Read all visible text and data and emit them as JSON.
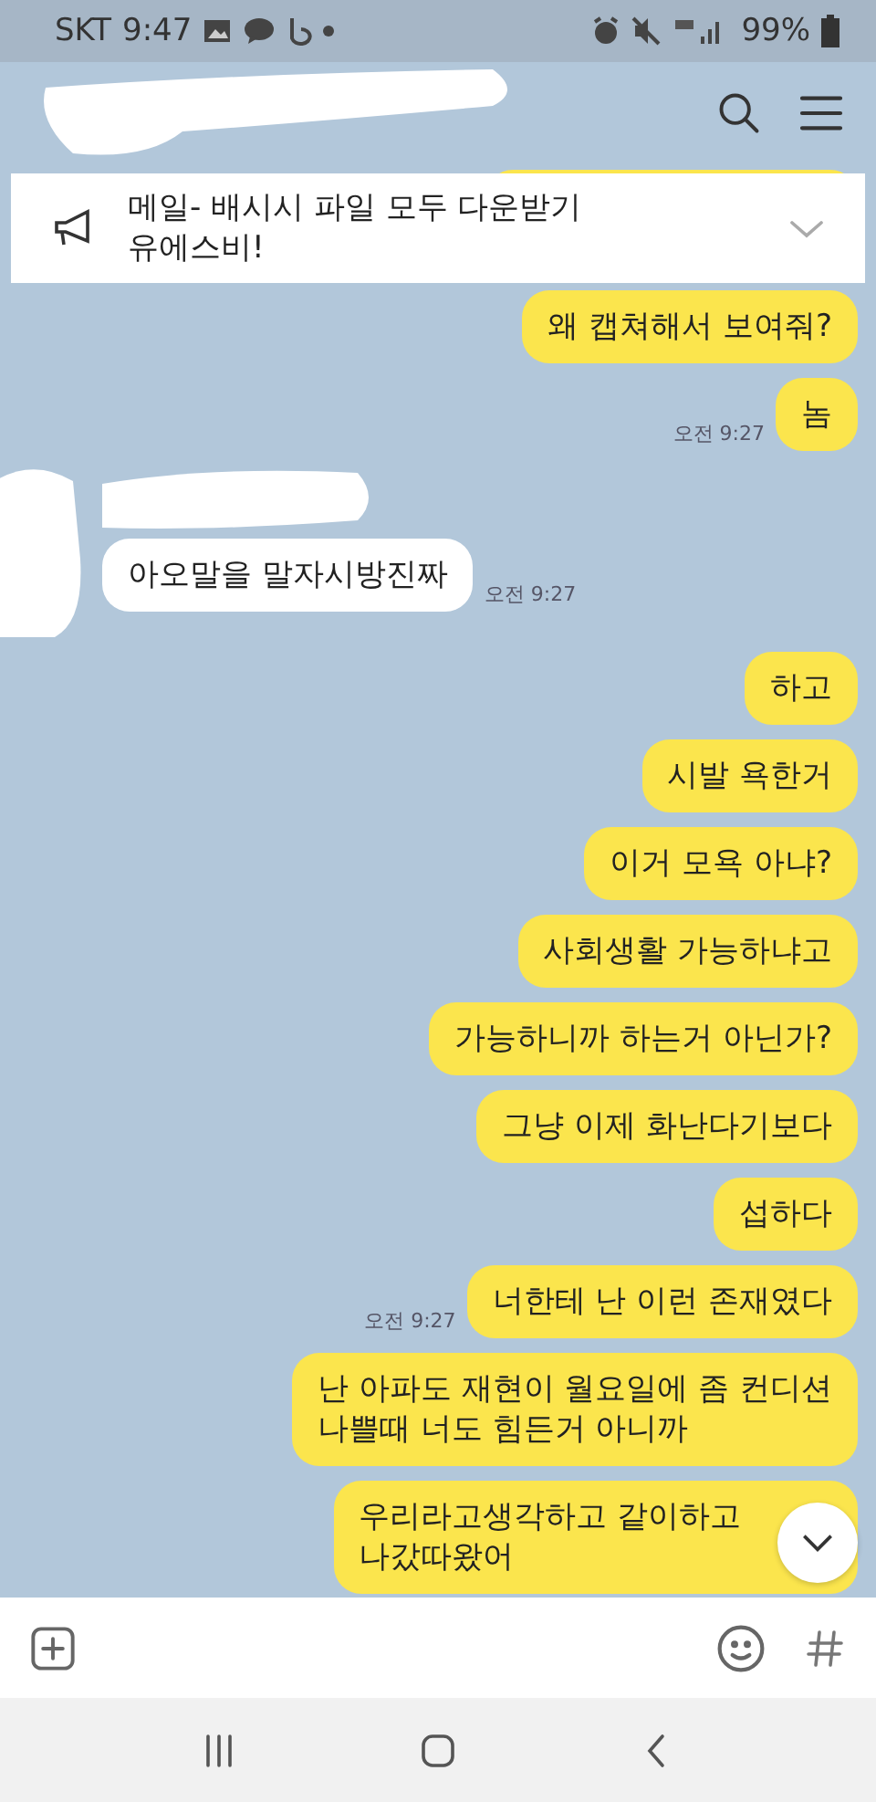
{
  "status_bar": {
    "carrier": "SKT",
    "time": "9:47",
    "battery": "99%"
  },
  "notice": {
    "text": "메일- 배시시 파일 모두 다운받기\n유에스비!"
  },
  "messages": [
    {
      "kind": "partial"
    },
    {
      "kind": "sent",
      "text": "왜 캡쳐해서 보여줘?"
    },
    {
      "kind": "sent",
      "text": "놈",
      "time": "오전 9:27"
    },
    {
      "kind": "received",
      "text": "아오말을 말자시방진짜",
      "time": "오전 9:27"
    },
    {
      "kind": "sent",
      "text": "하고"
    },
    {
      "kind": "sent",
      "text": "시발 욕한거"
    },
    {
      "kind": "sent",
      "text": "이거 모욕 아냐?"
    },
    {
      "kind": "sent",
      "text": "사회생활 가능하냐고"
    },
    {
      "kind": "sent",
      "text": "가능하니까 하는거 아닌가?"
    },
    {
      "kind": "sent",
      "text": "그냥 이제 화난다기보다"
    },
    {
      "kind": "sent",
      "text": "섭하다"
    },
    {
      "kind": "sent",
      "text": "너한테 난 이런 존재였다",
      "time": "오전 9:27"
    },
    {
      "kind": "sent",
      "text": "난 아파도 재현이 월요일에 좀 컨디션\n나쁠때 너도 힘든거 아니까"
    },
    {
      "kind": "sent",
      "text": "우리라고생각하고 같이하고\n나갔따왔어"
    }
  ]
}
